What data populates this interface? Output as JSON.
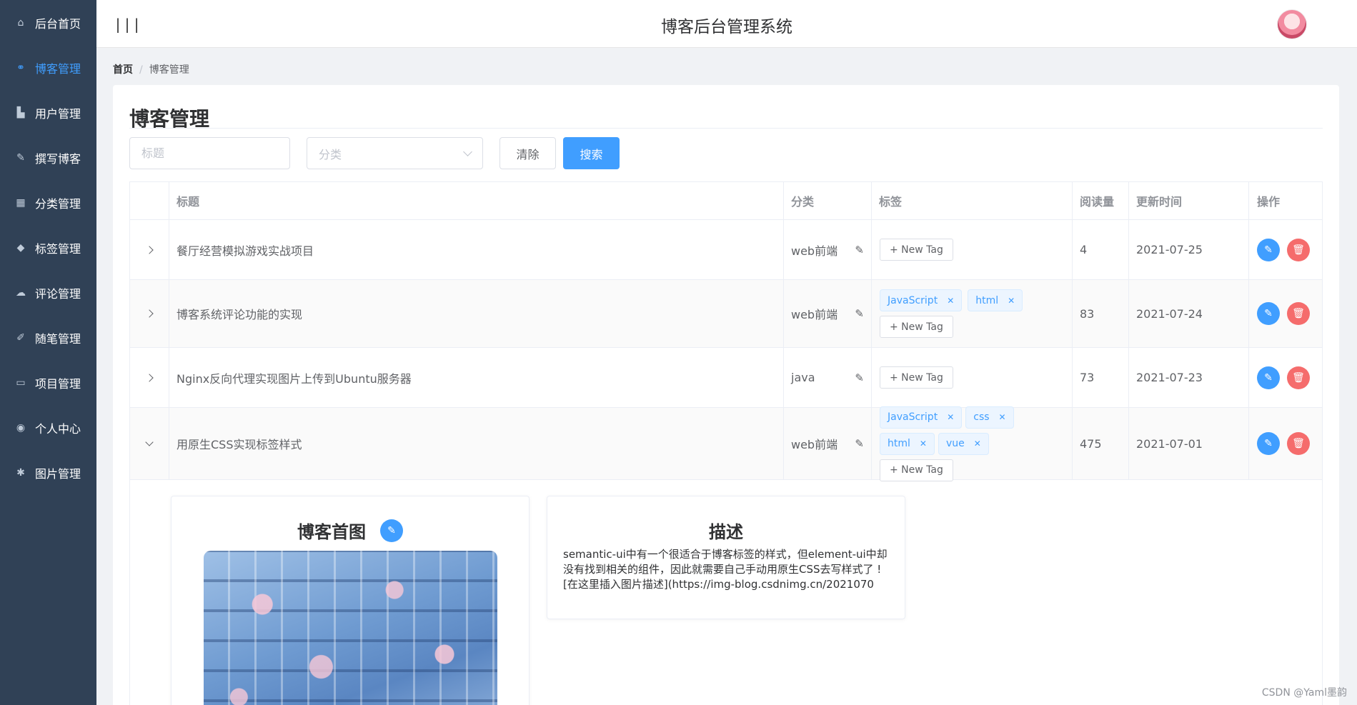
{
  "app": {
    "title": "博客后台管理系统"
  },
  "sidebar": {
    "items": [
      {
        "label": "后台首页",
        "icon": "home-icon",
        "active": false
      },
      {
        "label": "博客管理",
        "icon": "share-icon",
        "active": true
      },
      {
        "label": "用户管理",
        "icon": "user-icon",
        "active": false
      },
      {
        "label": "撰写博客",
        "icon": "pen-icon",
        "active": false
      },
      {
        "label": "分类管理",
        "icon": "grid-icon",
        "active": false
      },
      {
        "label": "标签管理",
        "icon": "tag-icon",
        "active": false
      },
      {
        "label": "评论管理",
        "icon": "comment-icon",
        "active": false
      },
      {
        "label": "随笔管理",
        "icon": "note-icon",
        "active": false
      },
      {
        "label": "项目管理",
        "icon": "monitor-icon",
        "active": false
      },
      {
        "label": "个人中心",
        "icon": "person-circle-icon",
        "active": false
      },
      {
        "label": "图片管理",
        "icon": "pin-icon",
        "active": false
      }
    ]
  },
  "breadcrumb": {
    "home": "首页",
    "separator": "/",
    "current": "博客管理"
  },
  "page": {
    "title": "博客管理"
  },
  "filters": {
    "title_placeholder": "标题",
    "category_placeholder": "分类",
    "clear_label": "清除",
    "search_label": "搜索"
  },
  "table": {
    "headers": {
      "title": "标题",
      "category": "分类",
      "tags": "标签",
      "views": "阅读量",
      "updated": "更新时间",
      "ops": "操作"
    },
    "new_tag_label": "+ New Tag",
    "rows": [
      {
        "title": "餐厅经营模拟游戏实战项目",
        "category": "web前端",
        "tags": [],
        "views": "4",
        "updated": "2021-07-25",
        "expanded": false
      },
      {
        "title": "博客系统评论功能的实现",
        "category": "web前端",
        "tags": [
          "JavaScript",
          "html"
        ],
        "views": "83",
        "updated": "2021-07-24",
        "expanded": false
      },
      {
        "title": "Nginx反向代理实现图片上传到Ubuntu服务器",
        "category": "java",
        "tags": [],
        "views": "73",
        "updated": "2021-07-23",
        "expanded": false
      },
      {
        "title": "用原生CSS实现标签样式",
        "category": "web前端",
        "tags": [
          "JavaScript",
          "css",
          "html",
          "vue"
        ],
        "views": "475",
        "updated": "2021-07-01",
        "expanded": true
      }
    ]
  },
  "expanded_detail": {
    "cover_title": "博客首图",
    "desc_title": "描述",
    "description": "semantic-ui中有一个很适合于博客标签的样式，但element-ui中却没有找到相关的组件，因此就需要自己手动用原生CSS去写样式了 ![在这里插入图片描述](https://img-blog.csdnimg.cn/2021070"
  },
  "watermark": "CSDN @Yaml墨韵",
  "colors": {
    "sidebar_bg": "#304156",
    "primary": "#409eff",
    "danger": "#f56c6c"
  }
}
